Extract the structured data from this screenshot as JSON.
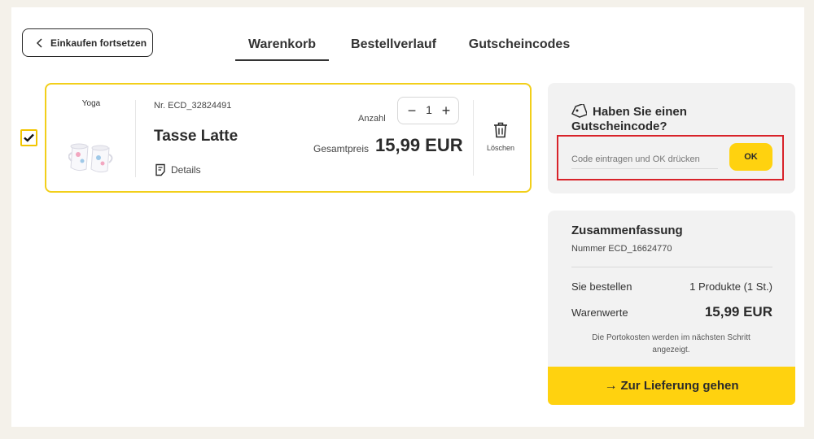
{
  "nav": {
    "back_label": "Einkaufen fortsetzen",
    "tabs": [
      {
        "label": "Warenkorb",
        "active": true
      },
      {
        "label": "Bestellverlauf",
        "active": false
      },
      {
        "label": "Gutscheincodes",
        "active": false
      }
    ]
  },
  "cart_item": {
    "selected": true,
    "category": "Yoga",
    "product_nr": "Nr. ECD_32824491",
    "title": "Tasse Latte",
    "details_label": "Details",
    "quantity_label": "Anzahl",
    "quantity": "1",
    "total_label": "Gesamtpreis",
    "total_price": "15,99 EUR",
    "delete_label": "Löschen"
  },
  "coupon": {
    "title": "Haben Sie einen Gutscheincode?",
    "placeholder": "Code eintragen und OK drücken",
    "button_label": "OK"
  },
  "summary": {
    "title": "Zusammenfassung",
    "order_number": "Nummer ECD_16624770",
    "rows": [
      {
        "label": "Sie bestellen",
        "value": "1 Produkte (1 St.)"
      },
      {
        "label": "Warenwerte",
        "value": "15,99 EUR"
      }
    ],
    "shipping_note": "Die Portokosten werden im nächsten Schritt angezeigt.",
    "cta_label": "Zur Lieferung gehen"
  },
  "colors": {
    "accent_yellow": "#ffd20f",
    "highlight_red": "#d8232a",
    "panel_gray": "#f2f2f2"
  }
}
